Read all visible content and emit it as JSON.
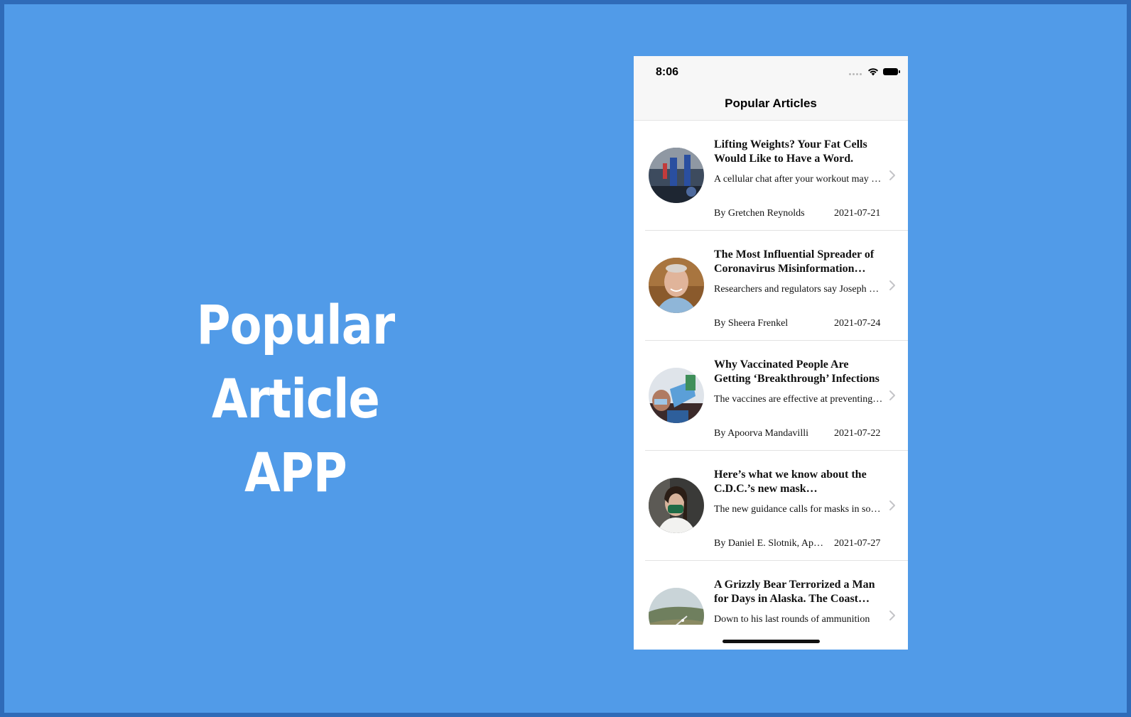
{
  "promo": {
    "title_line1": "Popular Article",
    "title_line2": "APP"
  },
  "status_bar": {
    "time": "8:06",
    "icons": [
      "signal-dots-icon",
      "wifi-icon",
      "battery-icon"
    ]
  },
  "nav": {
    "title": "Popular Articles"
  },
  "articles": [
    {
      "title": "Lifting Weights? Your Fat Cells Would Like to Have a Word.",
      "abstract": "A cellular chat after your workout may help explain how strength training burns fat.",
      "byline": "By Gretchen Reynolds",
      "date": "2021-07-21",
      "thumb": "gym-photo"
    },
    {
      "title": "The Most Influential Spreader of Coronavirus Misinformation Online",
      "abstract": "Researchers and regulators say Joseph Mercola",
      "byline": "By Sheera Frenkel",
      "date": "2021-07-24",
      "thumb": "portrait-photo"
    },
    {
      "title": "Why Vaccinated People Are Getting ‘Breakthrough’ Infections",
      "abstract": "The vaccines are effective at preventing serious illness",
      "byline": "By Apoorva Mandavilli",
      "date": "2021-07-22",
      "thumb": "testing-photo"
    },
    {
      "title": "Here’s what we know about the C.D.C.’s new mask recommendations",
      "abstract": "The new guidance calls for masks in some indoor settings",
      "byline": "By Daniel E. Slotnik, Apoorva Mandavilli",
      "date": "2021-07-27",
      "thumb": "mask-photo"
    },
    {
      "title": "A Grizzly Bear Terrorized a Man for Days in Alaska. The Coast Guard Rescued Him.",
      "abstract": "Down to his last rounds of ammunition",
      "byline": "",
      "date": "",
      "thumb": "landscape-photo"
    }
  ]
}
